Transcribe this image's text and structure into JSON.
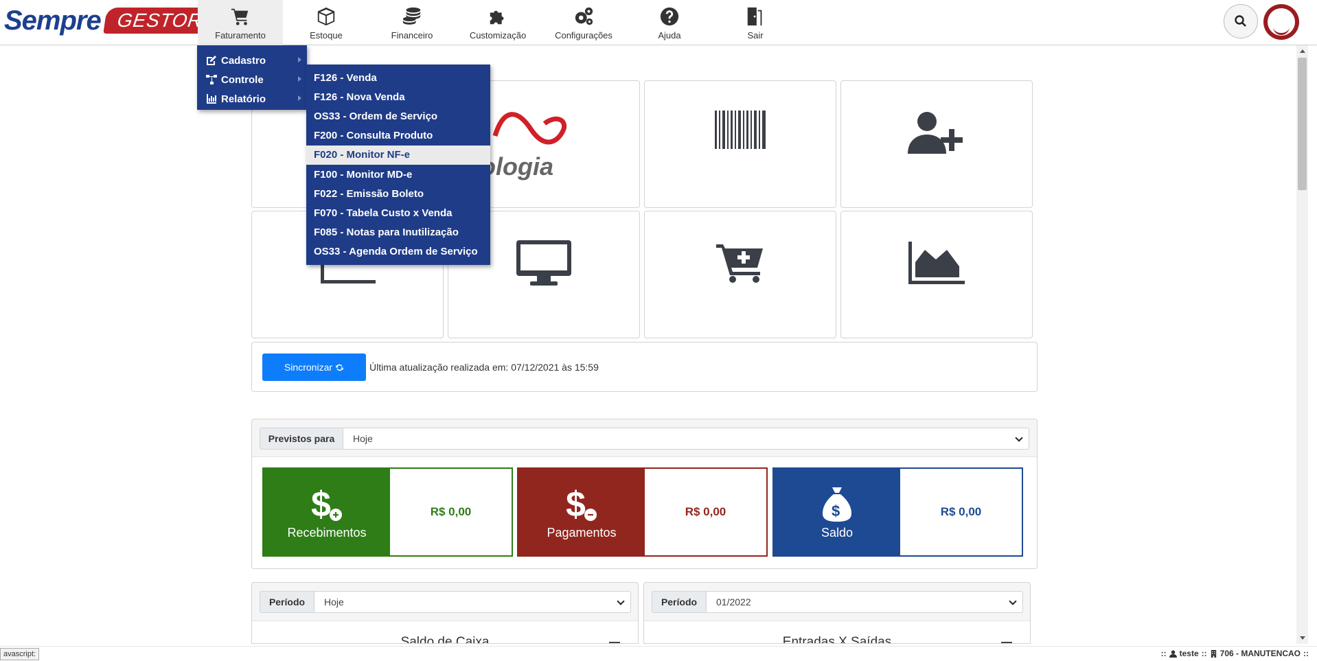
{
  "brand": {
    "sempre": "Sempre",
    "gestor": "GESTOR",
    "color_blue": "#1d3f8f",
    "color_red": "#c0242b"
  },
  "nav": {
    "items": [
      {
        "label": "Faturamento",
        "icon": "cart-icon"
      },
      {
        "label": "Estoque",
        "icon": "box-icon"
      },
      {
        "label": "Financeiro",
        "icon": "coins-icon"
      },
      {
        "label": "Customização",
        "icon": "puzzle-icon"
      },
      {
        "label": "Configurações",
        "icon": "gears-icon"
      },
      {
        "label": "Ajuda",
        "icon": "question-icon"
      },
      {
        "label": "Sair",
        "icon": "door-exit-icon"
      }
    ],
    "active": "Faturamento"
  },
  "menu": {
    "level1": [
      {
        "label": "Cadastro",
        "icon": "edit-icon"
      },
      {
        "label": "Controle",
        "icon": "sitemap-icon"
      },
      {
        "label": "Relatório",
        "icon": "bar-chart-icon"
      }
    ],
    "level2": [
      {
        "label": "F126 - Venda"
      },
      {
        "label": "F126 - Nova Venda"
      },
      {
        "label": "OS33 - Ordem de Serviço"
      },
      {
        "label": "F200 - Consulta Produto"
      },
      {
        "label": "F020 - Monitor NF-e"
      },
      {
        "label": "F100 - Monitor MD-e"
      },
      {
        "label": "F022 - Emissão Boleto"
      },
      {
        "label": "F070 - Tabela Custo x Venda"
      },
      {
        "label": "F085 - Notas para Inutilização"
      },
      {
        "label": "OS33 - Agenda Ordem de Serviço"
      }
    ],
    "hovered": "F020 - Monitor NF-e",
    "bg_color": "#1f3c88"
  },
  "tiles": {
    "brand_fragment": "ologia",
    "icons": [
      "logo-tile-icon",
      "barcode-icon",
      "user-plus-icon",
      "chart-tile-icon",
      "monitor-icon",
      "cart-plus-icon",
      "area-chart-icon"
    ]
  },
  "sync": {
    "button_label": "Sincronizar",
    "last_update": "Última atualização realizada em: 07/12/2021 às 15:59"
  },
  "finance": {
    "filter_label": "Previstos para",
    "filter_value": "Hoje",
    "cards": [
      {
        "label": "Recebimentos",
        "value": "R$ 0,00",
        "color": "#2e7d17"
      },
      {
        "label": "Pagamentos",
        "value": "R$ 0,00",
        "color": "#91261e"
      },
      {
        "label": "Saldo",
        "value": "R$ 0,00",
        "color": "#1e4a93"
      }
    ]
  },
  "panels": [
    {
      "filter_label": "Período",
      "filter_value": "Hoje",
      "title": "Saldo de Caixa"
    },
    {
      "filter_label": "Período",
      "filter_value": "01/2022",
      "title": "Entradas X Saídas"
    }
  ],
  "status": {
    "js_tip": "avascript:",
    "sep": "::",
    "user": "teste",
    "company": "706 - MANUTENCAO"
  }
}
